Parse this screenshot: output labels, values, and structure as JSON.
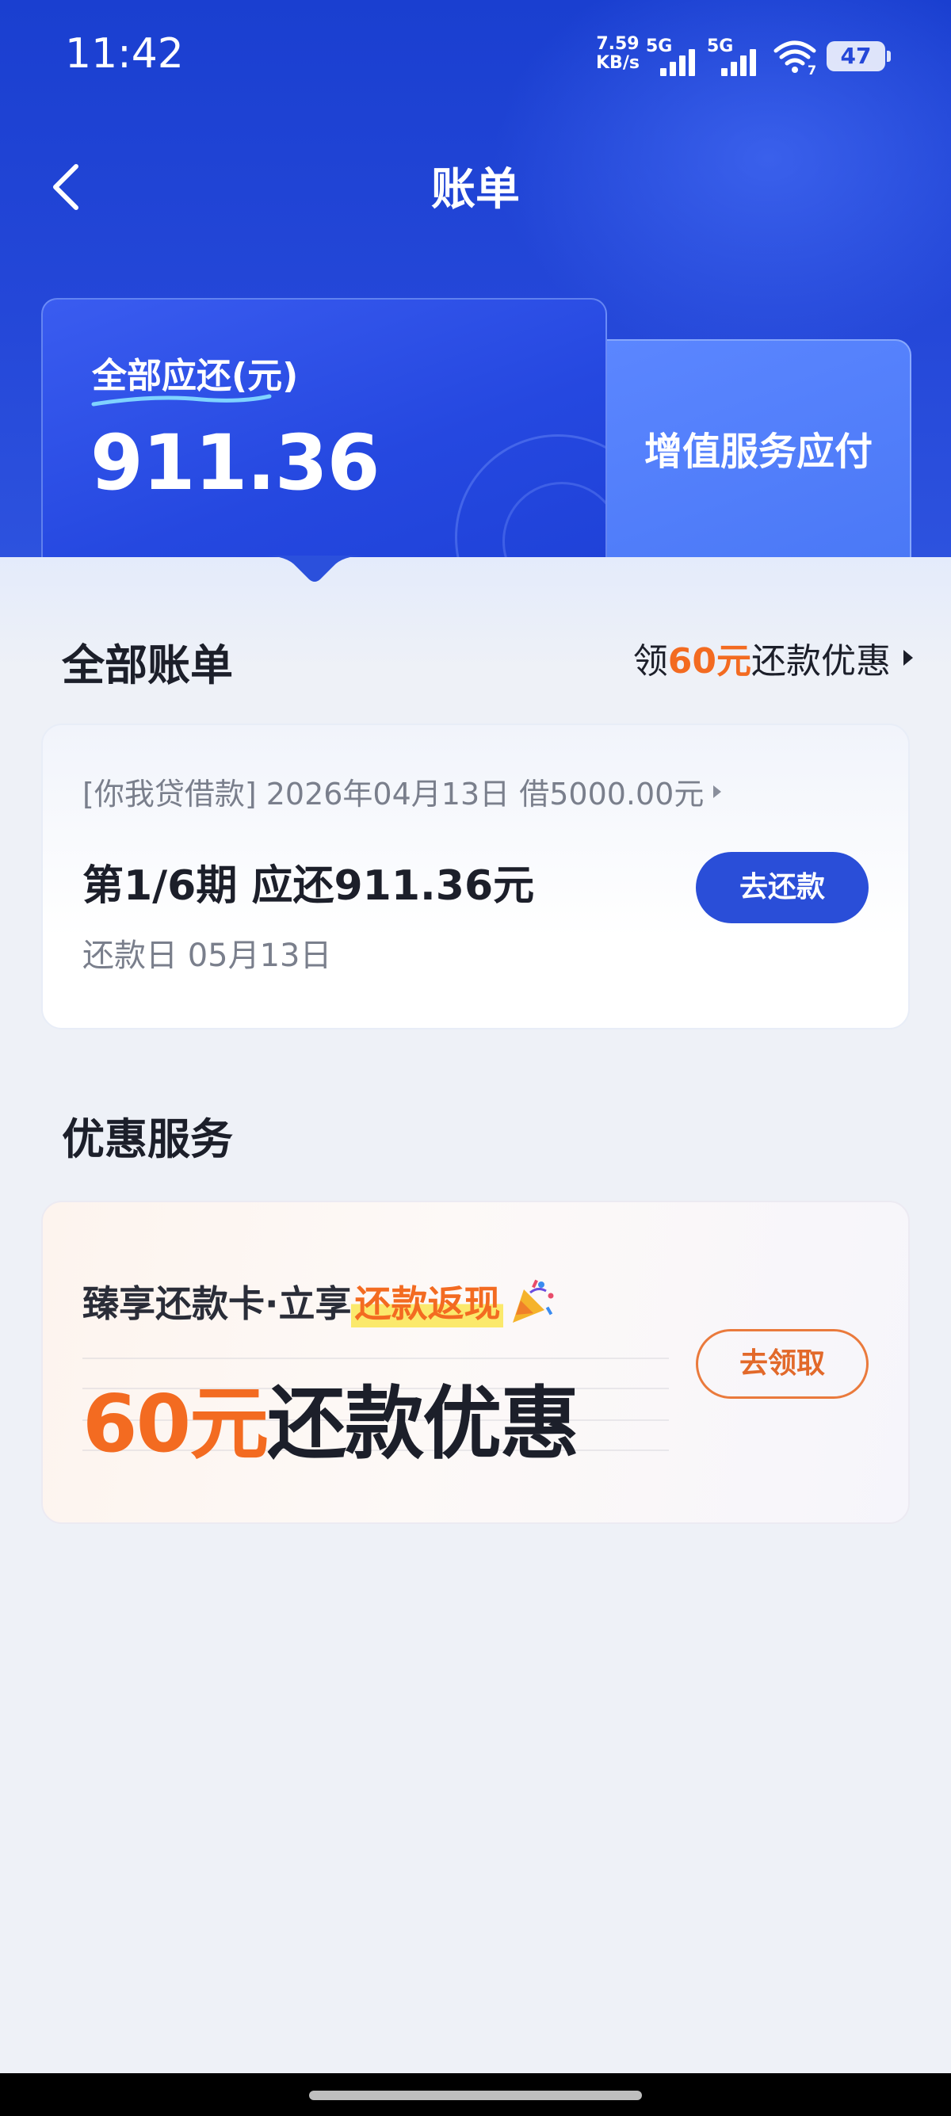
{
  "status_bar": {
    "time": "11:42",
    "net_speed": "7.59",
    "net_unit": "KB/s",
    "sim1": "5G",
    "sim2": "5G",
    "wifi_badge": "7",
    "battery": "47"
  },
  "nav": {
    "title": "账单",
    "back_icon": "chevron-left-icon"
  },
  "summary": {
    "label": "全部应还(元)",
    "amount": "911.36",
    "side_label": "增值服务应付"
  },
  "bills": {
    "section_title": "全部账单",
    "promo_prefix": "领",
    "promo_amount": "60元",
    "promo_suffix": "还款优惠",
    "card": {
      "loan_info": "[你我贷借款] 2026年04月13日 借5000.00元",
      "period": "第1/6期 应还911.36元",
      "due": "还款日 05月13日",
      "button": "去还款"
    }
  },
  "services": {
    "section_title": "优惠服务",
    "card": {
      "sub_prefix": "臻享还款卡·立享",
      "sub_highlight": "还款返现",
      "big_amount": "60元",
      "big_text": "还款优惠",
      "button": "去领取"
    }
  },
  "colors": {
    "primary": "#2a4ed8",
    "accent": "#f36b21",
    "hero": "#1a3fd0"
  }
}
